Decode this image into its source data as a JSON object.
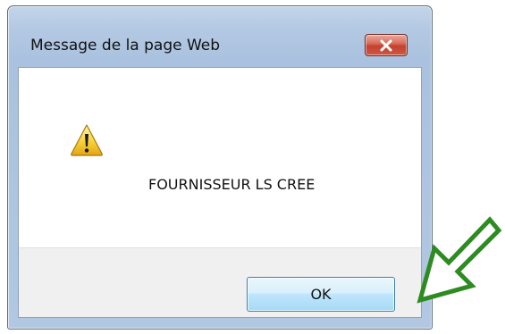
{
  "window": {
    "title": "Message de la page Web",
    "close_icon": "close-icon"
  },
  "content": {
    "icon": "warning-icon",
    "message": "FOURNISSEUR LS CREE"
  },
  "buttons": {
    "ok_label": "OK"
  },
  "annotation": {
    "icon": "arrow-icon",
    "color": "#2e8b22"
  },
  "colors": {
    "close_button": "#c9473a",
    "ok_button_border": "#3c7fb1",
    "frame": "#b4c9e3"
  }
}
